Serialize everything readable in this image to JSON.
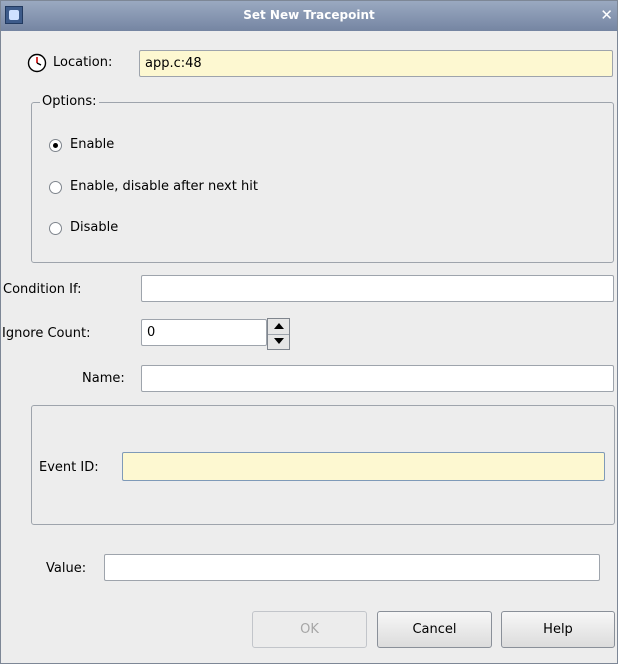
{
  "window": {
    "title": "Set New Tracepoint"
  },
  "location": {
    "label": "Location:",
    "value": "app.c:48"
  },
  "options": {
    "legend": "Options:",
    "radios": [
      {
        "label": "Enable",
        "checked": true
      },
      {
        "label": "Enable, disable after next hit",
        "checked": false
      },
      {
        "label": "Disable",
        "checked": false
      }
    ]
  },
  "condition": {
    "label": "Condition If:",
    "value": ""
  },
  "ignore_count": {
    "label": "Ignore Count:",
    "value": "0"
  },
  "name": {
    "label": "Name:",
    "value": ""
  },
  "event_id": {
    "label": "Event ID:",
    "value": ""
  },
  "value_field": {
    "label": "Value:",
    "value": ""
  },
  "buttons": {
    "ok": "OK",
    "cancel": "Cancel",
    "help": "Help"
  },
  "colors": {
    "titlebar": "#7585a2",
    "highlight_field": "#fdf8d1",
    "window_bg": "#ededed"
  }
}
